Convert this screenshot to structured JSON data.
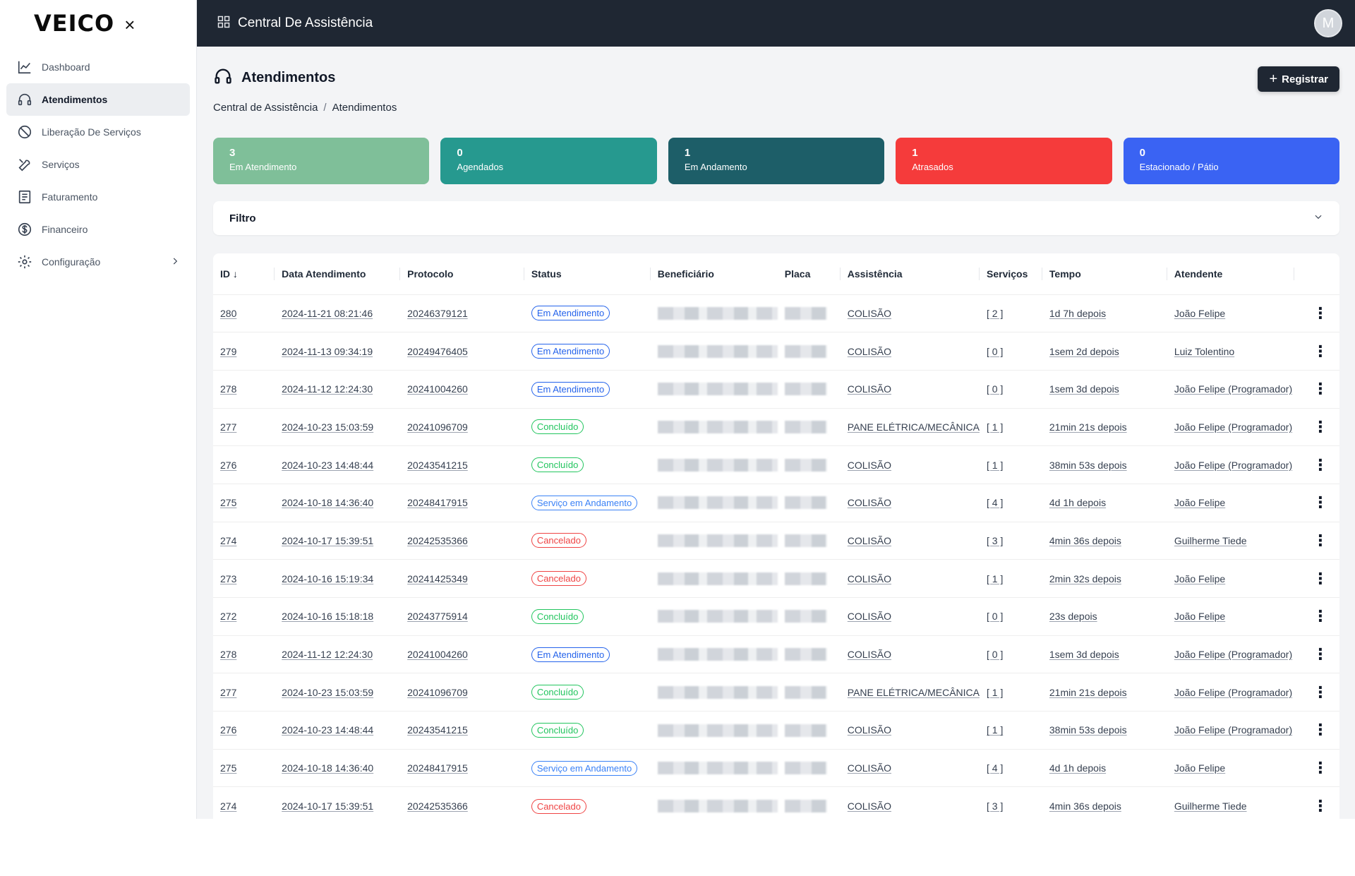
{
  "app": {
    "logo": "VEICO",
    "close_glyph": "×"
  },
  "sidebar": {
    "items": [
      {
        "label": "Dashboard",
        "icon": "chart-line-icon",
        "active": false
      },
      {
        "label": "Atendimentos",
        "icon": "headset-icon",
        "active": true
      },
      {
        "label": "Liberação De Serviços",
        "icon": "ban-icon",
        "active": false
      },
      {
        "label": "Serviços",
        "icon": "tools-icon",
        "active": false
      },
      {
        "label": "Faturamento",
        "icon": "invoice-icon",
        "active": false
      },
      {
        "label": "Financeiro",
        "icon": "dollar-circle-icon",
        "active": false
      },
      {
        "label": "Configuração",
        "icon": "gear-icon",
        "active": false,
        "has_submenu": true
      }
    ]
  },
  "topbar": {
    "title": "Central De Assistência",
    "avatar_initial": "M"
  },
  "page": {
    "title": "Atendimentos",
    "register_label": "Registrar",
    "breadcrumb": [
      "Central de Assistência",
      "Atendimentos"
    ]
  },
  "cards": [
    {
      "count": "3",
      "label": "Em Atendimento",
      "color": "#7fbf99"
    },
    {
      "count": "0",
      "label": "Agendados",
      "color": "#26998f"
    },
    {
      "count": "1",
      "label": "Em Andamento",
      "color": "#1d5e68"
    },
    {
      "count": "1",
      "label": "Atrasados",
      "color": "#f53b3b"
    },
    {
      "count": "0",
      "label": "Estacionado / Pátio",
      "color": "#3a63f3"
    }
  ],
  "filter": {
    "label": "Filtro"
  },
  "table": {
    "columns": [
      "ID",
      "Data Atendimento",
      "Protocolo",
      "Status",
      "Beneficiário",
      "Placa",
      "Assistência",
      "Serviços",
      "Tempo",
      "Atendente"
    ],
    "status_colors": {
      "Em Atendimento": "#2563eb",
      "Concluído": "#22c55e",
      "Serviço em Andamento": "#3b82f6",
      "Cancelado": "#ef4444"
    },
    "rows": [
      {
        "id": "280",
        "data": "2024-11-21 08:21:46",
        "protocolo": "20246379121",
        "status": "Em Atendimento",
        "assistencia": "COLISÃO",
        "servicos": "[ 2 ]",
        "tempo": "1d 7h depois",
        "atendente": "João Felipe"
      },
      {
        "id": "279",
        "data": "2024-11-13 09:34:19",
        "protocolo": "20249476405",
        "status": "Em Atendimento",
        "assistencia": "COLISÃO",
        "servicos": "[ 0 ]",
        "tempo": "1sem 2d depois",
        "atendente": "Luiz Tolentino"
      },
      {
        "id": "278",
        "data": "2024-11-12 12:24:30",
        "protocolo": "20241004260",
        "status": "Em Atendimento",
        "assistencia": "COLISÃO",
        "servicos": "[ 0 ]",
        "tempo": "1sem 3d depois",
        "atendente": "João Felipe (Programador)"
      },
      {
        "id": "277",
        "data": "2024-10-23 15:03:59",
        "protocolo": "20241096709",
        "status": "Concluído",
        "assistencia": "PANE ELÉTRICA/MECÂNICA",
        "servicos": "[ 1 ]",
        "tempo": "21min 21s depois",
        "atendente": "João Felipe (Programador)"
      },
      {
        "id": "276",
        "data": "2024-10-23 14:48:44",
        "protocolo": "20243541215",
        "status": "Concluído",
        "assistencia": "COLISÃO",
        "servicos": "[ 1 ]",
        "tempo": "38min 53s depois",
        "atendente": "João Felipe (Programador)"
      },
      {
        "id": "275",
        "data": "2024-10-18 14:36:40",
        "protocolo": "20248417915",
        "status": "Serviço em Andamento",
        "assistencia": "COLISÃO",
        "servicos": "[ 4 ]",
        "tempo": "4d 1h depois",
        "atendente": "João Felipe"
      },
      {
        "id": "274",
        "data": "2024-10-17 15:39:51",
        "protocolo": "20242535366",
        "status": "Cancelado",
        "assistencia": "COLISÃO",
        "servicos": "[ 3 ]",
        "tempo": "4min 36s depois",
        "atendente": "Guilherme Tiede"
      },
      {
        "id": "273",
        "data": "2024-10-16 15:19:34",
        "protocolo": "20241425349",
        "status": "Cancelado",
        "assistencia": "COLISÃO",
        "servicos": "[ 1 ]",
        "tempo": "2min 32s depois",
        "atendente": "João Felipe"
      },
      {
        "id": "272",
        "data": "2024-10-16 15:18:18",
        "protocolo": "20243775914",
        "status": "Concluído",
        "assistencia": "COLISÃO",
        "servicos": "[ 0 ]",
        "tempo": "23s depois",
        "atendente": "João Felipe"
      },
      {
        "id": "278",
        "data": "2024-11-12 12:24:30",
        "protocolo": "20241004260",
        "status": "Em Atendimento",
        "assistencia": "COLISÃO",
        "servicos": "[ 0 ]",
        "tempo": "1sem 3d depois",
        "atendente": "João Felipe (Programador)"
      },
      {
        "id": "277",
        "data": "2024-10-23 15:03:59",
        "protocolo": "20241096709",
        "status": "Concluído",
        "assistencia": "PANE ELÉTRICA/MECÂNICA",
        "servicos": "[ 1 ]",
        "tempo": "21min 21s depois",
        "atendente": "João Felipe (Programador)"
      },
      {
        "id": "276",
        "data": "2024-10-23 14:48:44",
        "protocolo": "20243541215",
        "status": "Concluído",
        "assistencia": "COLISÃO",
        "servicos": "[ 1 ]",
        "tempo": "38min 53s depois",
        "atendente": "João Felipe (Programador)"
      },
      {
        "id": "275",
        "data": "2024-10-18 14:36:40",
        "protocolo": "20248417915",
        "status": "Serviço em Andamento",
        "assistencia": "COLISÃO",
        "servicos": "[ 4 ]",
        "tempo": "4d 1h depois",
        "atendente": "João Felipe"
      },
      {
        "id": "274",
        "data": "2024-10-17 15:39:51",
        "protocolo": "20242535366",
        "status": "Cancelado",
        "assistencia": "COLISÃO",
        "servicos": "[ 3 ]",
        "tempo": "4min 36s depois",
        "atendente": "Guilherme Tiede"
      }
    ]
  }
}
